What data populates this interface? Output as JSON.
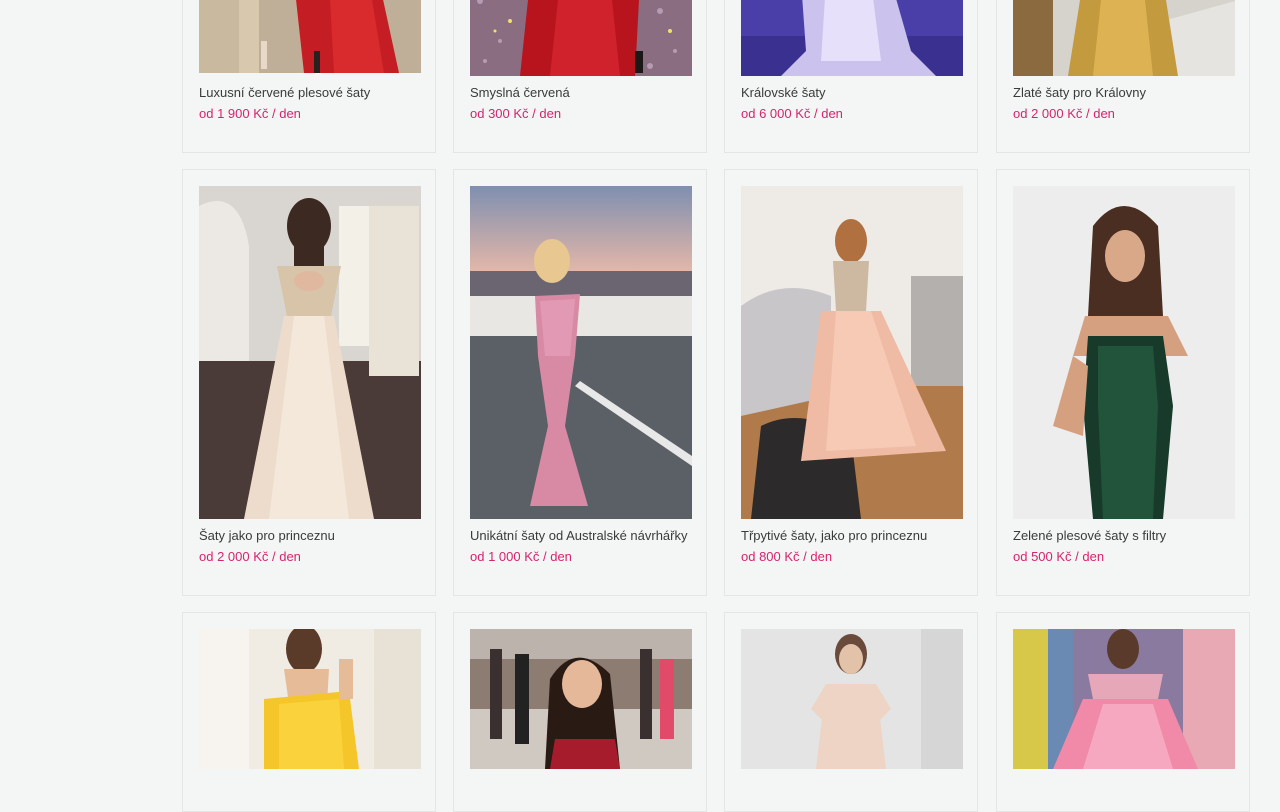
{
  "products": [
    {
      "title": "Luxusní červené plesové šaty",
      "price": "od 1 900 Kč / den",
      "image": "red-gown-photo"
    },
    {
      "title": "Smyslná červená",
      "price": "od 300 Kč / den",
      "image": "red-sequin-dress-photo"
    },
    {
      "title": "Královské šaty",
      "price": "od 6 000 Kč / den",
      "image": "lilac-lace-gown-photo"
    },
    {
      "title": "Zlaté šaty pro Královny",
      "price": "od 2 000 Kč / den",
      "image": "gold-sequin-gown-photo"
    },
    {
      "title": "Šaty jako pro princeznu",
      "price": "od 2 000 Kč / den",
      "image": "champagne-tulle-gown-photo"
    },
    {
      "title": "Unikátní šaty od Australské návrhářky",
      "price": "od 1 000 Kč / den",
      "image": "pink-mermaid-dress-photo"
    },
    {
      "title": "Třpytivé šaty, jako pro princeznu",
      "price": "od 800 Kč / den",
      "image": "peach-ballgown-photo"
    },
    {
      "title": "Zelené plesové šaty s filtry",
      "price": "od 500 Kč / den",
      "image": "green-sequin-dress-photo"
    },
    {
      "title": "",
      "price": "",
      "image": "yellow-offshoulder-dress-photo"
    },
    {
      "title": "",
      "price": "",
      "image": "red-dress-portrait-photo"
    },
    {
      "title": "",
      "price": "",
      "image": "blush-embroidered-dress-photo"
    },
    {
      "title": "",
      "price": "",
      "image": "pink-glitter-gown-photo"
    }
  ],
  "colors": {
    "background": "#f4f5f5",
    "price": "#d6246e",
    "title": "#3a3a3a",
    "border": "#e4e6e6"
  }
}
